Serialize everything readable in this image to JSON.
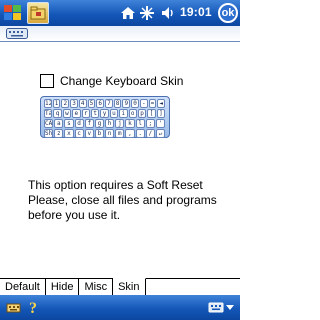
{
  "titlebar": {
    "clock": "19:01",
    "ok_label": "ok",
    "icons": [
      "windows-start-icon",
      "app-folder-icon",
      "home-icon",
      "connectivity-icon",
      "volume-icon"
    ]
  },
  "header": {
    "icon": "keyboard-icon"
  },
  "option": {
    "checkbox_label": "Change Keyboard Skin",
    "checked": false
  },
  "keyboard_preview": {
    "rows": [
      [
        "123",
        "1",
        "2",
        "3",
        "4",
        "5",
        "6",
        "7",
        "8",
        "9",
        "0",
        "-",
        "=",
        "◄"
      ],
      [
        "Tab",
        "q",
        "w",
        "e",
        "r",
        "t",
        "y",
        "u",
        "i",
        "o",
        "p",
        "[",
        "]"
      ],
      [
        "CAP",
        "a",
        "s",
        "d",
        "f",
        "g",
        "h",
        "j",
        "k",
        "l",
        ";",
        "'"
      ],
      [
        "Shift",
        "z",
        "x",
        "c",
        "v",
        "b",
        "n",
        "m",
        ",",
        ".",
        "/",
        "↵"
      ]
    ]
  },
  "message": {
    "line1": "This option requires a Soft Reset",
    "line2": "Please, close all files and programs",
    "line3": "before you use it."
  },
  "tabs": [
    {
      "label": "Default",
      "active": false
    },
    {
      "label": "Hide",
      "active": false
    },
    {
      "label": "Misc",
      "active": false
    },
    {
      "label": "Skin",
      "active": true
    }
  ],
  "bottombar": {
    "icons": [
      "keyboard-settings-icon",
      "help-icon",
      "input-panel-icon"
    ]
  },
  "colors": {
    "titlebar": "#1457b8",
    "background": "#ffffff"
  }
}
